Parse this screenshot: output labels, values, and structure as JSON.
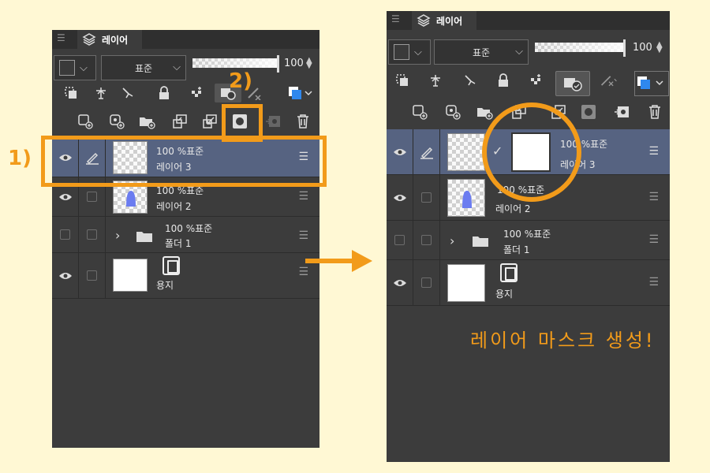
{
  "tab": {
    "title": "레이어"
  },
  "toolbar": {
    "blend_mode": "표준",
    "opacity": "100",
    "color_swatch_icon": "color-swatch-icon"
  },
  "layers_before": [
    {
      "opacity_mode": "100 %표준",
      "name": "레이어 3",
      "selected": true,
      "type": "raster"
    },
    {
      "opacity_mode": "100 %표준",
      "name": "레이어 2",
      "selected": false,
      "type": "raster"
    },
    {
      "opacity_mode": "100 %표준",
      "name": "폴더 1",
      "selected": false,
      "type": "folder"
    },
    {
      "opacity_mode": "",
      "name": "용지",
      "selected": false,
      "type": "paper"
    }
  ],
  "layers_after": [
    {
      "opacity_mode": "100 %표준",
      "name": "레이어 3",
      "selected": true,
      "type": "raster",
      "has_mask": true
    },
    {
      "opacity_mode": "100 %표준",
      "name": "레이어 2",
      "selected": false,
      "type": "raster"
    },
    {
      "opacity_mode": "100 %표준",
      "name": "폴더 1",
      "selected": false,
      "type": "folder"
    },
    {
      "opacity_mode": "",
      "name": "용지",
      "selected": false,
      "type": "paper"
    }
  ],
  "annotations": {
    "step1": "1)",
    "step2": "2)",
    "caption": "레이어 마스크 생성!"
  },
  "colors": {
    "accent": "#f29b1a",
    "panel": "#3c3c3c",
    "selected_row": "#566381",
    "background": "#fff8d4"
  }
}
